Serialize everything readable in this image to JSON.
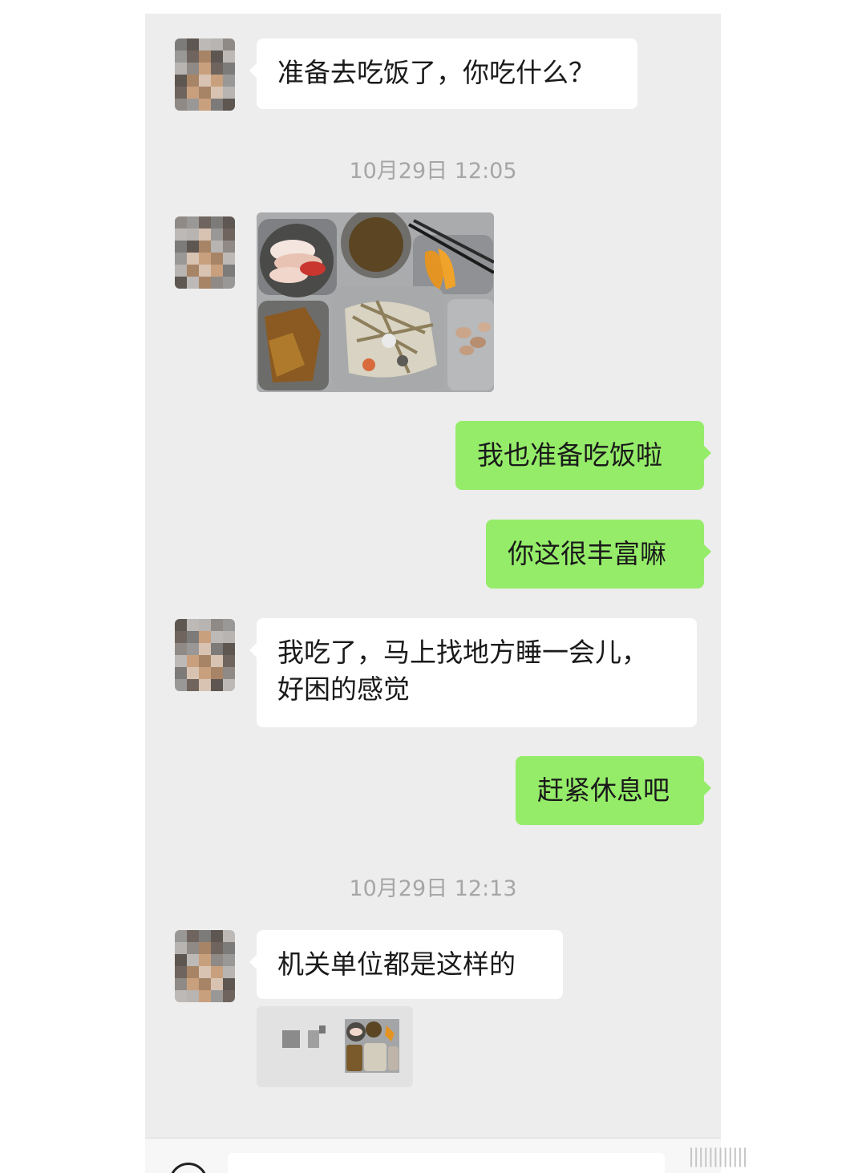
{
  "messages": {
    "m1_text": "准备去吃饭了，你吃什么？",
    "time1": "10月29日 12:05",
    "photo_alt": "food-tray-photo",
    "m3_text": "我也准备吃饭啦",
    "m4_text": "你这很丰富嘛",
    "m5_line1": "我吃了，马上找地方睡一会儿，",
    "m5_line2": "好困的感觉",
    "m6_text": "赶紧休息吧",
    "time2": "10月29日 12:13",
    "m7_text": "机关单位都是这样的"
  },
  "colors": {
    "chat_bg": "#ededed",
    "incoming_bubble": "#ffffff",
    "outgoing_bubble": "#95ec69",
    "timestamp": "#a6a6a6"
  },
  "icons": [
    "blurred-avatar",
    "voice-icon"
  ]
}
